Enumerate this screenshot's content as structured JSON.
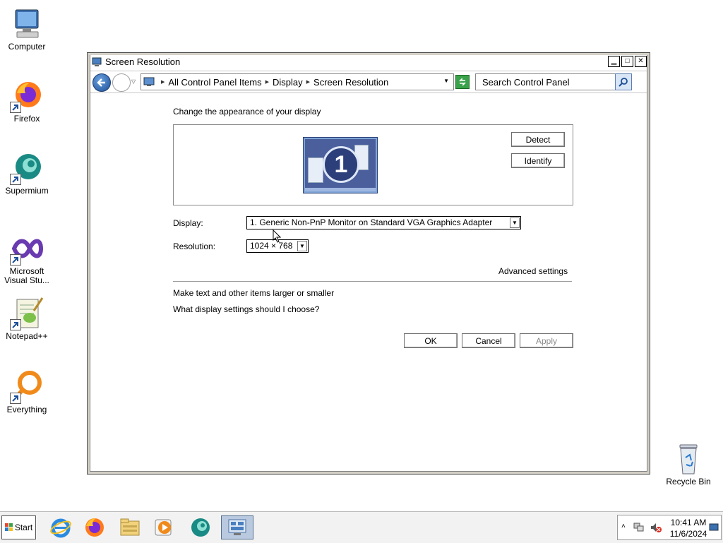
{
  "desktop": {
    "icons": [
      {
        "label": "Computer",
        "icon": "computer-icon"
      },
      {
        "label": "Firefox",
        "icon": "firefox-icon"
      },
      {
        "label": "Supermium",
        "icon": "supermium-icon"
      },
      {
        "label": "Microsoft Visual Stu...",
        "icon": "visual-studio-icon"
      },
      {
        "label": "Notepad++",
        "icon": "notepadpp-icon"
      },
      {
        "label": "Everything",
        "icon": "everything-icon"
      },
      {
        "label": "Recycle Bin",
        "icon": "recycle-bin-icon"
      }
    ]
  },
  "window": {
    "title": "Screen Resolution",
    "breadcrumb": [
      "All Control Panel Items",
      "Display",
      "Screen Resolution"
    ],
    "search_placeholder": "Search Control Panel"
  },
  "content": {
    "heading": "Change the appearance of your display",
    "monitor_number": "1",
    "detect_label": "Detect",
    "identify_label": "Identify",
    "display_label": "Display:",
    "display_value": "1. Generic Non-PnP Monitor on Standard VGA Graphics Adapter",
    "resolution_label": "Resolution:",
    "resolution_value": "1024 × 768",
    "advanced_settings": "Advanced settings",
    "link_text_size": "Make text and other items larger or smaller",
    "link_help": "What display settings should I choose?",
    "ok_label": "OK",
    "cancel_label": "Cancel",
    "apply_label": "Apply"
  },
  "taskbar": {
    "start_label": "Start",
    "apps": [
      "internet-explorer-icon",
      "firefox-icon",
      "file-explorer-icon",
      "media-player-icon",
      "supermium-icon",
      "control-panel-icon"
    ],
    "clock_time": "10:41 AM",
    "clock_date": "11/6/2024"
  },
  "colors": {
    "accent": "#1d4f97",
    "monitor_bg": "#4a5f9c"
  }
}
